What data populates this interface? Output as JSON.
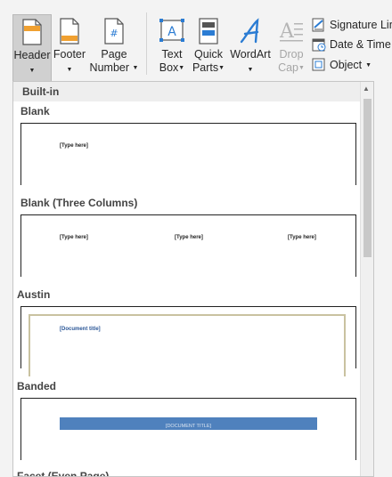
{
  "ribbon": {
    "header": {
      "label": "Header",
      "icon": "header-icon"
    },
    "footer": {
      "label1": "Footer",
      "icon": "footer-icon"
    },
    "page_number": {
      "label1": "Page",
      "label2": "Number",
      "icon": "page-number-icon"
    },
    "text_box": {
      "label1": "Text",
      "label2": "Box",
      "icon": "text-box-icon"
    },
    "quick_parts": {
      "label1": "Quick",
      "label2": "Parts",
      "icon": "quick-parts-icon"
    },
    "wordart": {
      "label1": "WordArt",
      "icon": "wordart-icon"
    },
    "drop_cap": {
      "label1": "Drop",
      "label2": "Cap",
      "icon": "drop-cap-icon"
    },
    "signature_line": {
      "label": "Signature Line",
      "icon": "signature-line-icon"
    },
    "date_time": {
      "label": "Date & Time",
      "icon": "date-time-icon"
    },
    "object": {
      "label": "Object",
      "icon": "object-icon"
    },
    "arrow_glyph": "▼"
  },
  "gallery": {
    "category": "Built-in",
    "items": [
      {
        "title": "Blank",
        "placeholders": [
          "[Type here]"
        ]
      },
      {
        "title": "Blank (Three Columns)",
        "placeholders": [
          "[Type here]",
          "[Type here]",
          "[Type here]"
        ]
      },
      {
        "title": "Austin",
        "placeholders": [
          "[Document title]"
        ]
      },
      {
        "title": "Banded",
        "placeholders": [
          "[DOCUMENT TITLE]"
        ]
      },
      {
        "title": "Facet (Even Page)",
        "placeholders": []
      }
    ]
  },
  "colors": {
    "accent_blue": "#2b7cd3",
    "banded_bar": "#4f81bd",
    "austin_border": "#c9c2a0"
  }
}
